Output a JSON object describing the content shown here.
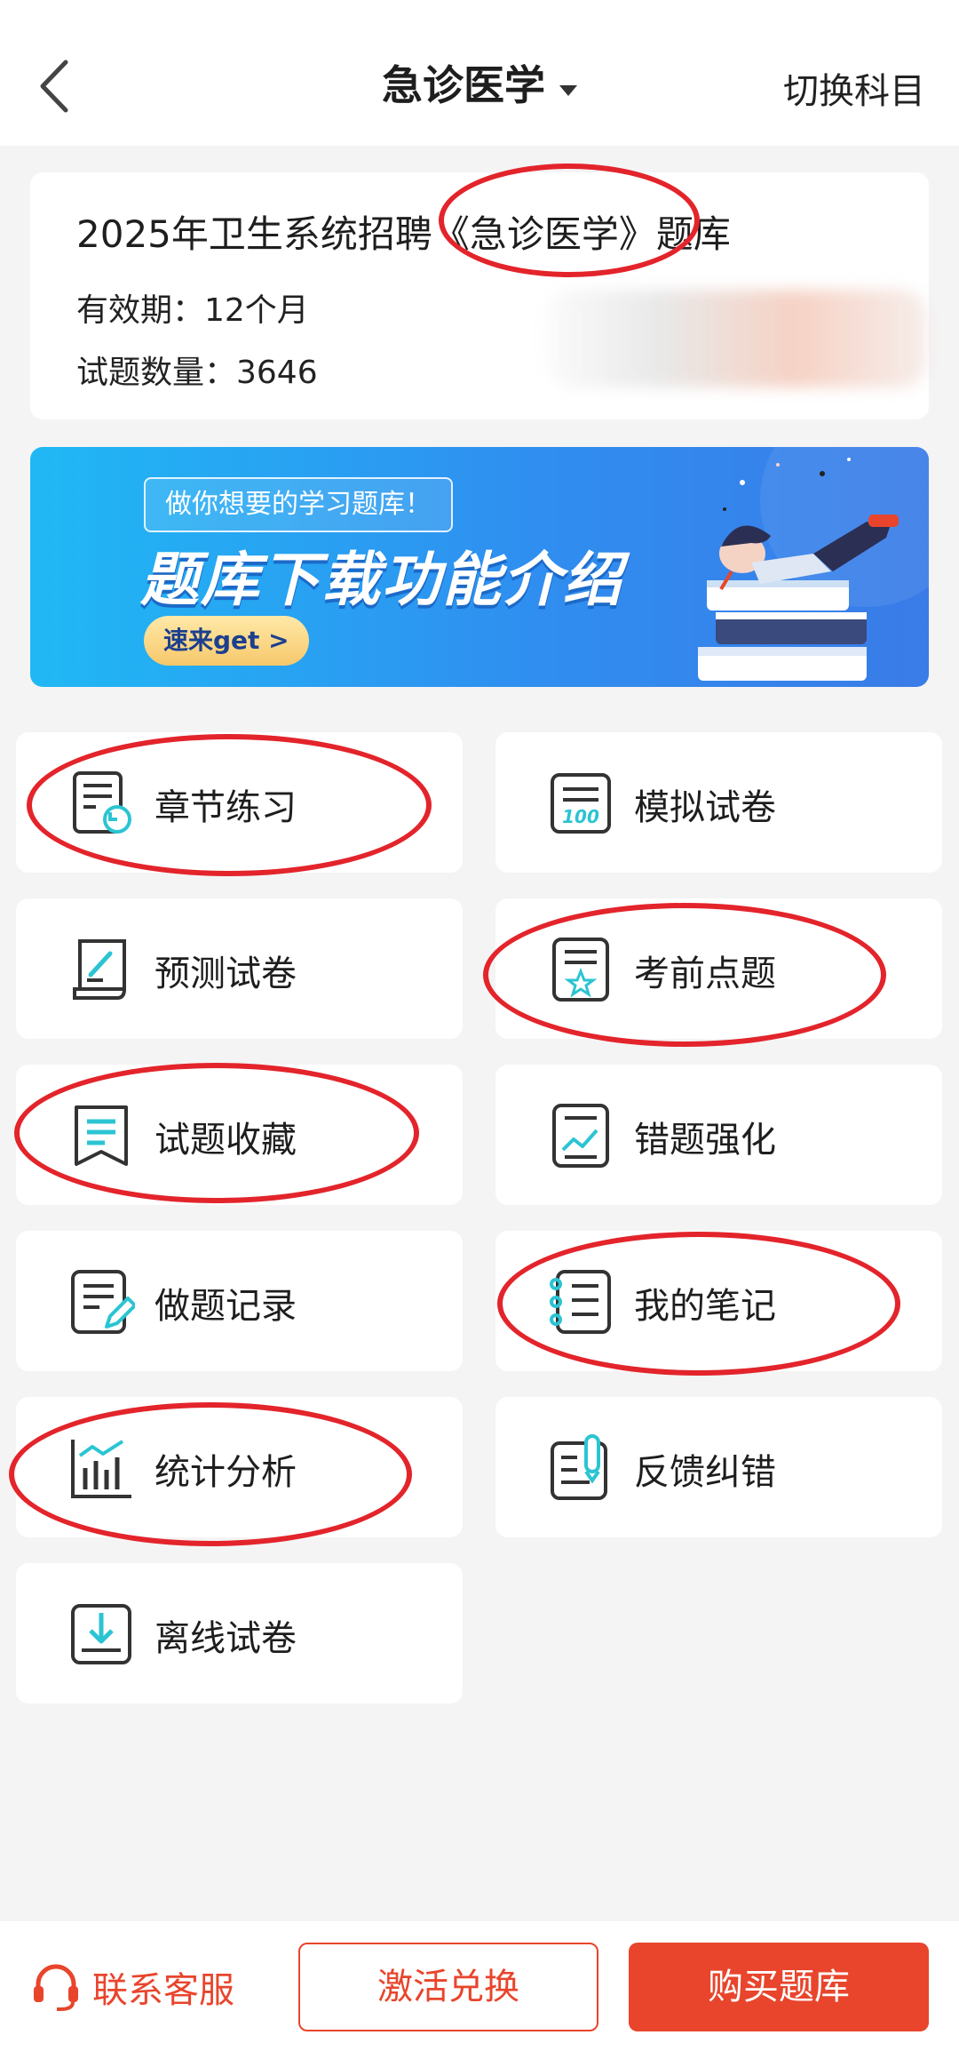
{
  "header": {
    "title": "急诊医学",
    "switch_label": "切换科目"
  },
  "info": {
    "title": "2025年卫生系统招聘《急诊医学》题库",
    "validity": "有效期：12个月",
    "count": "试题数量：3646"
  },
  "banner": {
    "tagline": "做你想要的学习题库！",
    "headline": "题库下载功能介绍",
    "cta": "速来get >"
  },
  "menu": [
    {
      "label": "章节练习",
      "icon": "chapter-practice-icon"
    },
    {
      "label": "模拟试卷",
      "icon": "mock-exam-icon"
    },
    {
      "label": "预测试卷",
      "icon": "prediction-exam-icon"
    },
    {
      "label": "考前点题",
      "icon": "pre-exam-tips-icon"
    },
    {
      "label": "试题收藏",
      "icon": "bookmark-icon"
    },
    {
      "label": "错题强化",
      "icon": "wrong-answers-icon"
    },
    {
      "label": "做题记录",
      "icon": "history-icon"
    },
    {
      "label": "我的笔记",
      "icon": "notebook-icon"
    },
    {
      "label": "统计分析",
      "icon": "statistics-icon"
    },
    {
      "label": "反馈纠错",
      "icon": "feedback-icon"
    },
    {
      "label": "离线试卷",
      "icon": "download-icon"
    }
  ],
  "footer": {
    "contact": "联系客服",
    "redeem": "激活兑换",
    "buy": "购买题库"
  },
  "colors": {
    "accent": "#e8452c",
    "icon_teal": "#2bc4d3",
    "annotation_red": "#e3242b"
  }
}
